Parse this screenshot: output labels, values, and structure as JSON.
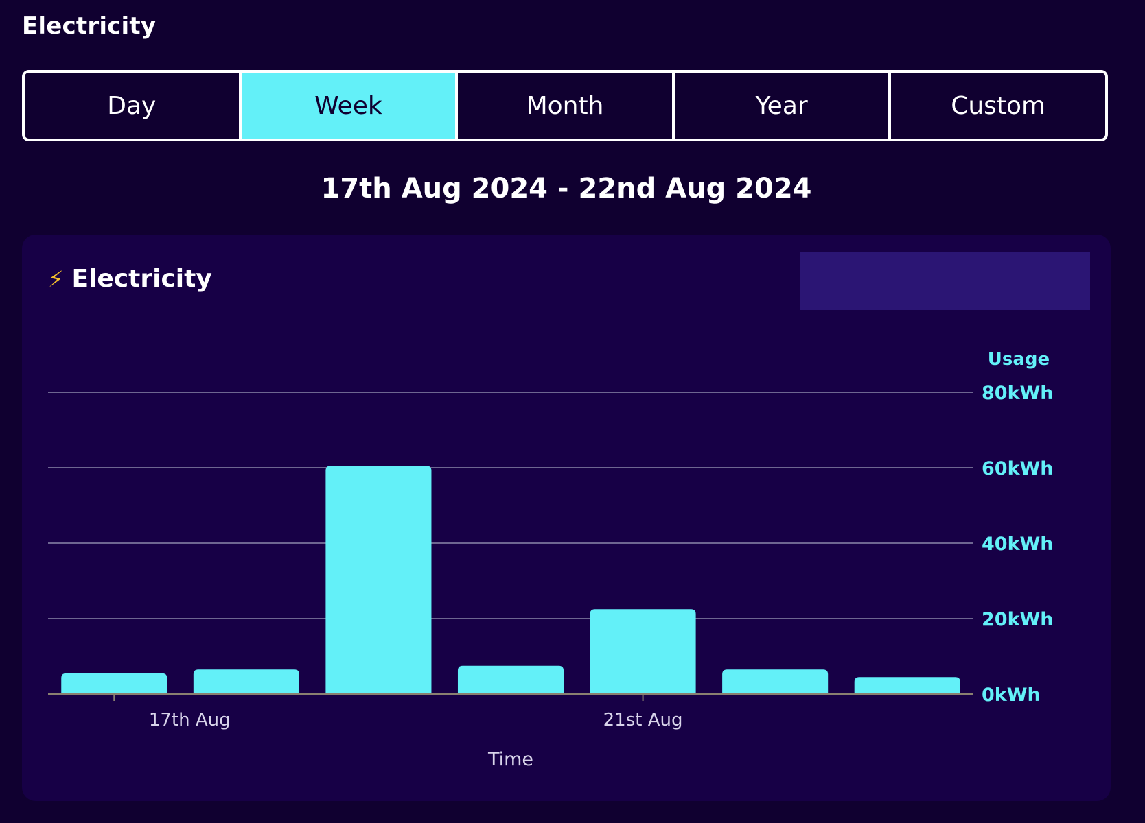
{
  "header": {
    "title": "Electricity"
  },
  "tabs": [
    {
      "label": "Day",
      "active": false
    },
    {
      "label": "Week",
      "active": true
    },
    {
      "label": "Month",
      "active": false
    },
    {
      "label": "Year",
      "active": false
    },
    {
      "label": "Custom",
      "active": false
    }
  ],
  "date_range": "17th Aug 2024 - 22nd Aug 2024",
  "card": {
    "icon": "lightning-bolt-icon",
    "title": "Electricity"
  },
  "colors": {
    "background": "#100030",
    "card": "#170046",
    "accent": "#63f0f8",
    "placeholder": "#2b1574",
    "gridline": "#6e6691"
  },
  "chart_data": {
    "type": "bar",
    "title": "",
    "xlabel": "Time",
    "ylabel": "Usage",
    "y_ticks": [
      "0kWh",
      "20kWh",
      "40kWh",
      "60kWh",
      "80kWh"
    ],
    "x_tick_labels": [
      {
        "label": "17th Aug",
        "index": 0
      },
      {
        "label": "21st Aug",
        "index": 4
      }
    ],
    "ylim": [
      0,
      80
    ],
    "unit": "kWh",
    "grid": true,
    "values": [
      5.5,
      6.5,
      60.5,
      7.5,
      22.5,
      6.5,
      4.5
    ]
  }
}
